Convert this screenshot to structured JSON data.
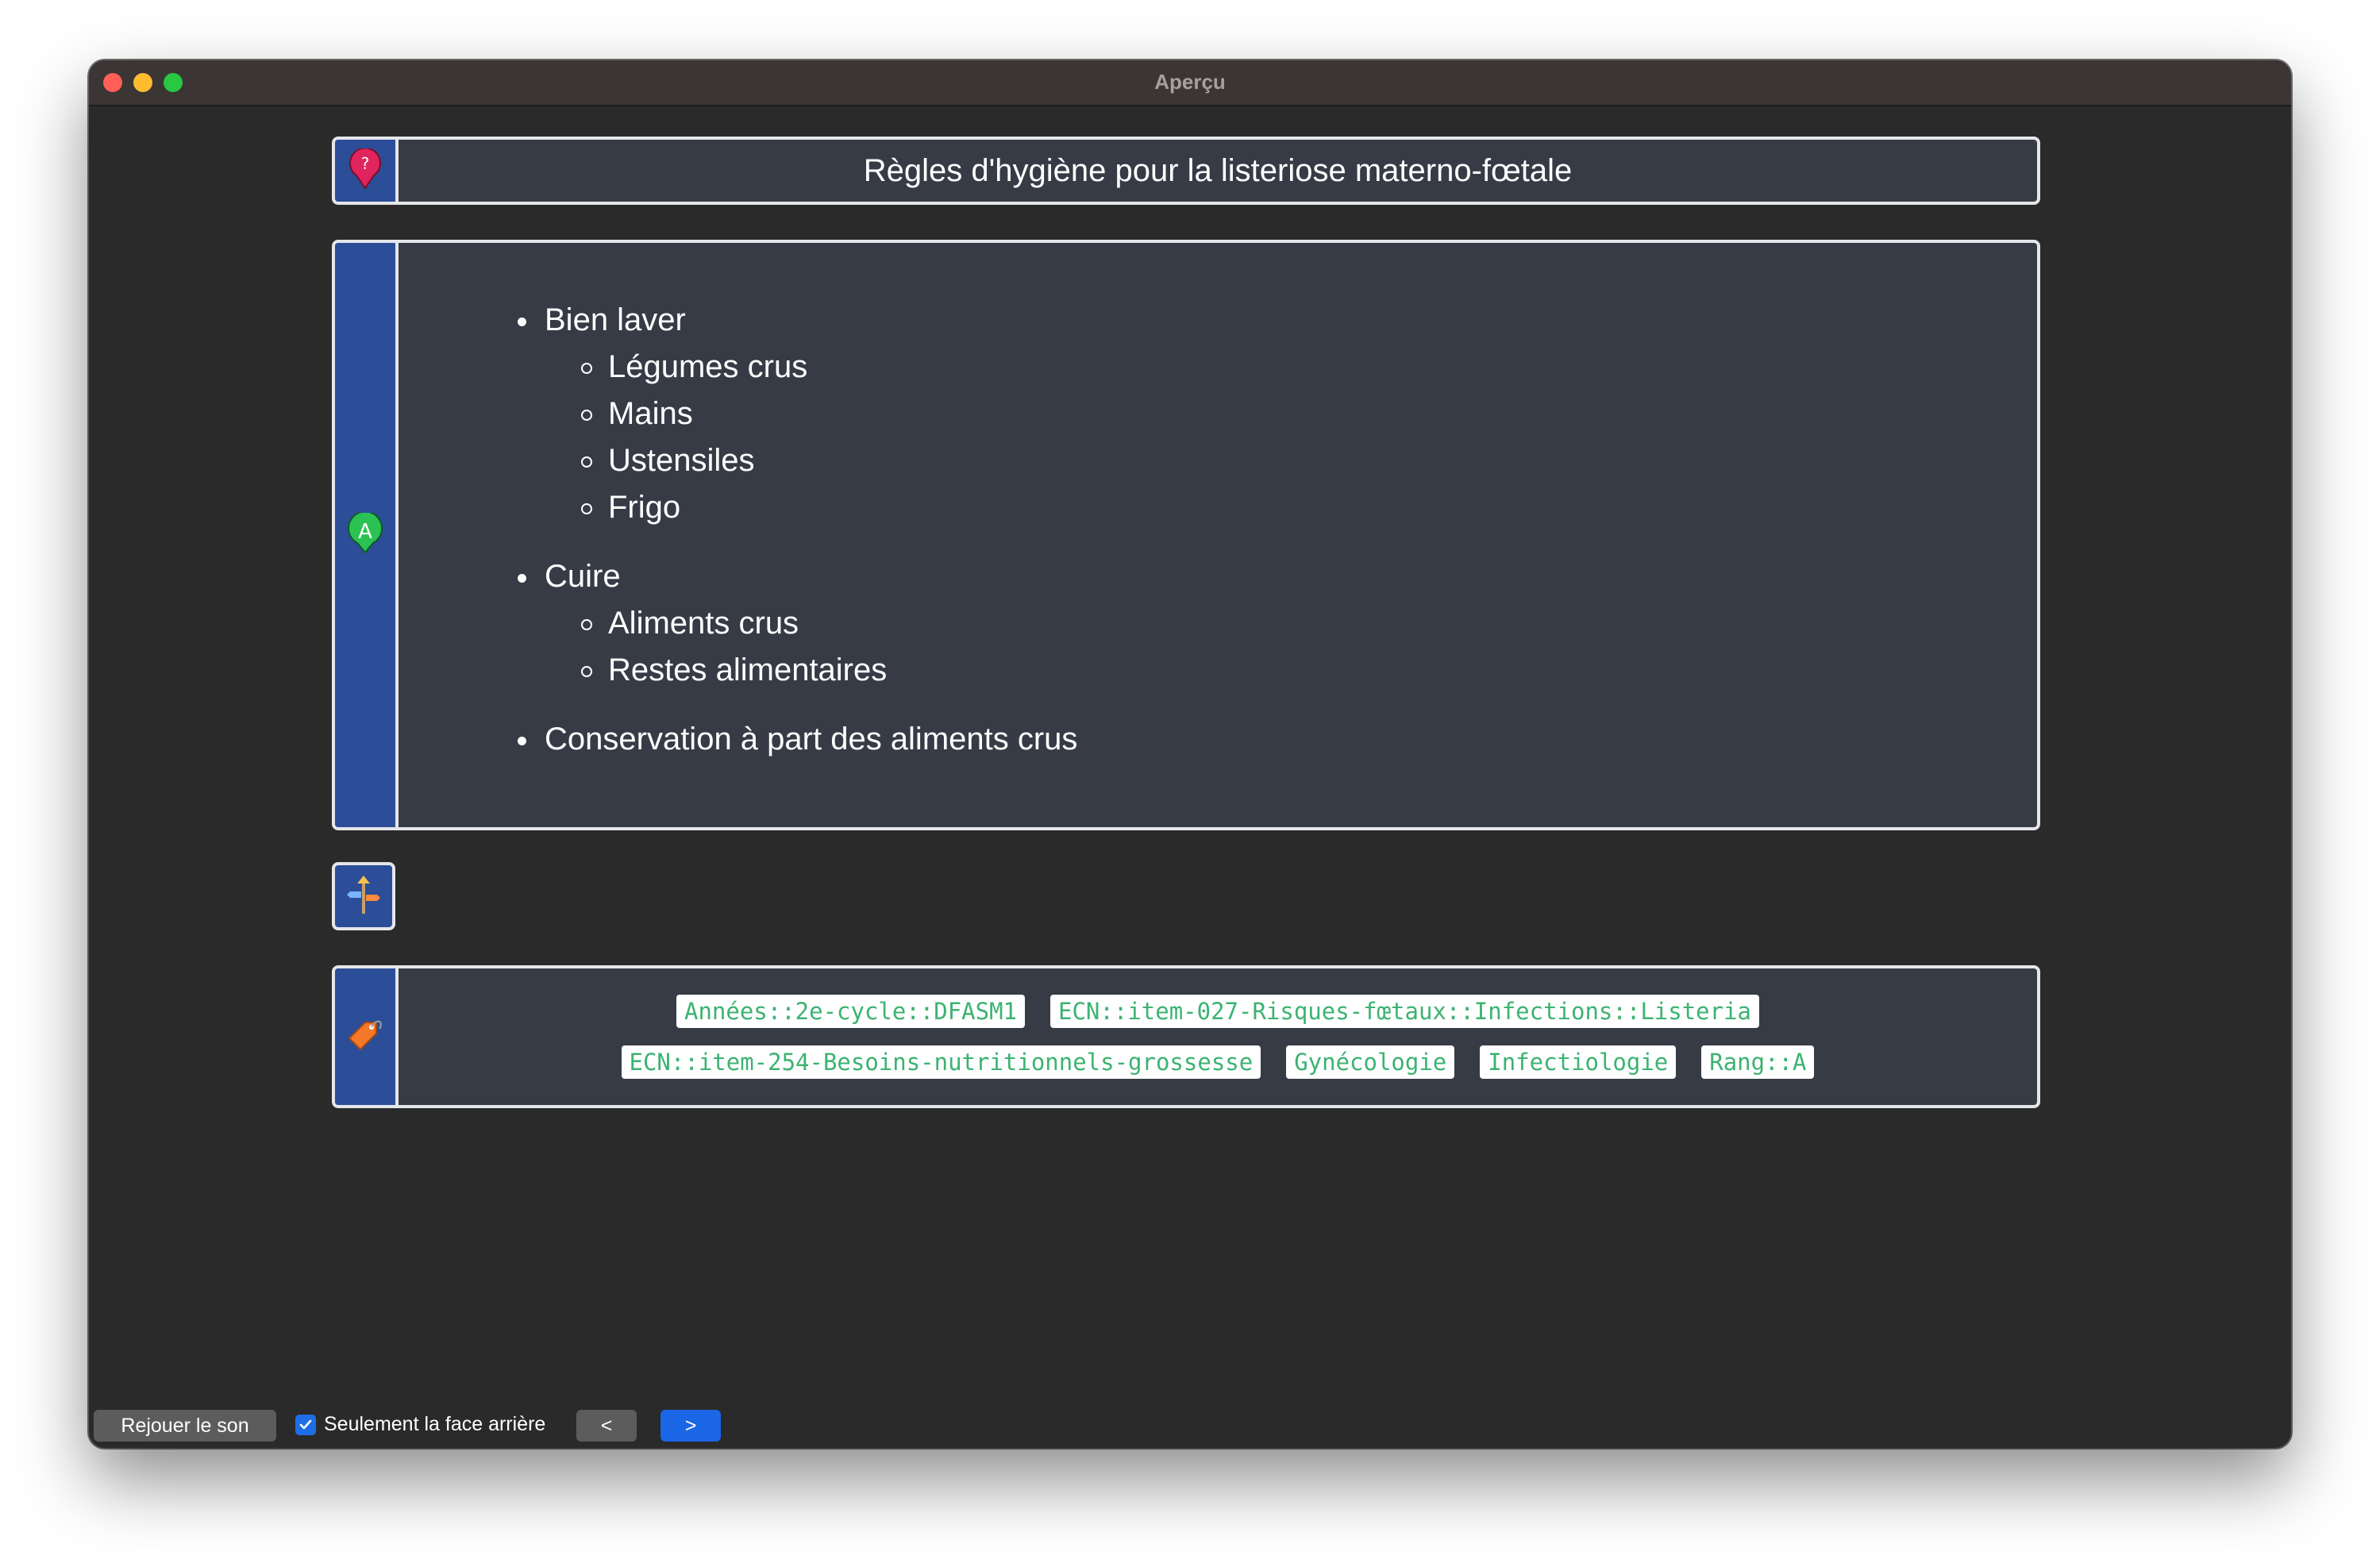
{
  "window": {
    "title": "Aperçu"
  },
  "question": {
    "text": "Règles d'hygiène pour la listeriose materno-fœtale",
    "icon": "question-pin-icon"
  },
  "answer": {
    "icon": "letter-a-icon",
    "items": [
      {
        "label": "Bien laver",
        "children": [
          "Légumes crus",
          "Mains",
          "Ustensiles",
          "Frigo"
        ]
      },
      {
        "label": "Cuire",
        "children": [
          "Aliments crus",
          "Restes alimentaires"
        ]
      },
      {
        "label": "Conservation à part des aliments crus",
        "children": []
      }
    ]
  },
  "extra": {
    "icon": "signpost-icon"
  },
  "tags": {
    "icon": "tag-icon",
    "rows": [
      [
        "Années::2e-cycle::DFASM1",
        "ECN::item-027-Risques-fœtaux::Infections::Listeria"
      ],
      [
        "ECN::item-254-Besoins-nutritionnels-grossesse",
        "Gynécologie",
        "Infectiologie",
        "Rang::A"
      ]
    ]
  },
  "bottom": {
    "replay_label": "Rejouer le son",
    "back_only_label": "Seulement la face arrière",
    "back_only_checked": true,
    "prev_label": "<",
    "next_label": ">"
  },
  "colors": {
    "accent_strip": "#2c4d98",
    "tag_text": "#3cb371",
    "next_button": "#1a66e6"
  }
}
